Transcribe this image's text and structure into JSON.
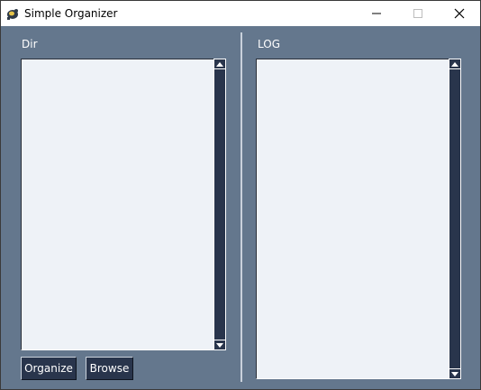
{
  "window": {
    "title": "Simple Organizer",
    "controls": {
      "minimize": "minimize",
      "maximize": "maximize",
      "close": "close"
    }
  },
  "left_pane": {
    "label": "Dir",
    "buttons": {
      "organize": "Organize",
      "browse": "Browse"
    }
  },
  "right_pane": {
    "label": "LOG"
  },
  "colors": {
    "background": "#64778d",
    "listbox": "#eef2f7",
    "button": "#29354c",
    "scrollbar": "#29354c"
  },
  "icons": [
    "app-icon",
    "minimize-icon",
    "maximize-icon",
    "close-icon",
    "scroll-up-arrow-icon",
    "scroll-down-arrow-icon"
  ]
}
